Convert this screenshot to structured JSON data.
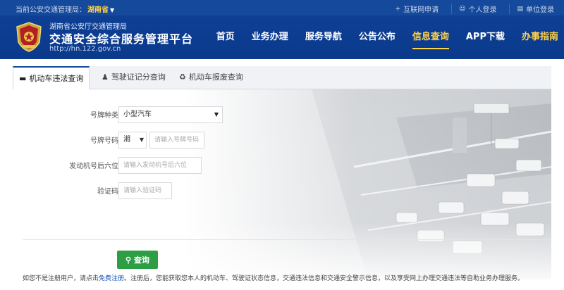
{
  "topbar": {
    "location_prefix": "当前公安交通管理局：",
    "province": "湖南省",
    "links": [
      {
        "icon": "plus-icon",
        "label": "互联网申请"
      },
      {
        "icon": "user-icon",
        "label": "个人登录"
      },
      {
        "icon": "doc-icon",
        "label": "单位登录"
      }
    ]
  },
  "header": {
    "subtitle": "湖南省公安厅交通管理局",
    "title": "交通安全综合服务管理平台",
    "url": "http://hn.122.gov.cn",
    "nav": [
      "首页",
      "业务办理",
      "服务导航",
      "公告公布",
      "信息查询",
      "APP下载",
      "办事指南"
    ],
    "nav_active": "信息查询"
  },
  "tabs": [
    {
      "icon": "car-icon",
      "label": "机动车违法查询",
      "active": true
    },
    {
      "icon": "person-icon",
      "label": "驾驶证记分查询",
      "active": false
    },
    {
      "icon": "trash-icon",
      "label": "机动车报废查询",
      "active": false
    }
  ],
  "form": {
    "plate_type_label": "号牌种类",
    "plate_type_value": "小型汽车",
    "plate_number_label": "号牌号码",
    "plate_prefix_value": "湘",
    "plate_number_placeholder": "请输入号牌号码",
    "engine_label": "发动机号后六位",
    "engine_placeholder": "请输入发动机号后六位",
    "captcha_label": "验证码",
    "captcha_placeholder": "请输入验证码",
    "submit_label": "查询"
  },
  "footer": {
    "text_before": "如您不是注册用户，请点击",
    "link_text": "免费注册",
    "text_after": "。注册后，您能获取您本人的机动车、驾驶证状态信息，交通违法信息和交通安全警示信息，以及享受网上办理交通违法等自助业务办理服务。"
  }
}
